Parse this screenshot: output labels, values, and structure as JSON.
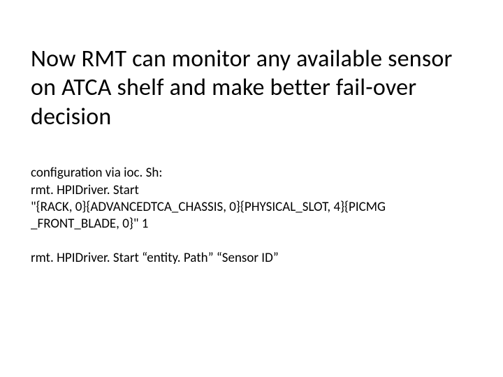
{
  "title": "Now RMT can monitor any available sensor on ATCA shelf and make better fail-over decision",
  "config": {
    "intro": "configuration via ioc. Sh:",
    "cmd1_l1": "rmt. HPIDriver. Start",
    "cmd1_l2": "\"{RACK, 0}{ADVANCEDTCA_CHASSIS, 0}{PHYSICAL_SLOT, 4}{PICMG",
    "cmd1_l3": "_FRONT_BLADE, 0}\" 1",
    "cmd2": "rmt. HPIDriver. Start “entity. Path” “Sensor ID”"
  }
}
